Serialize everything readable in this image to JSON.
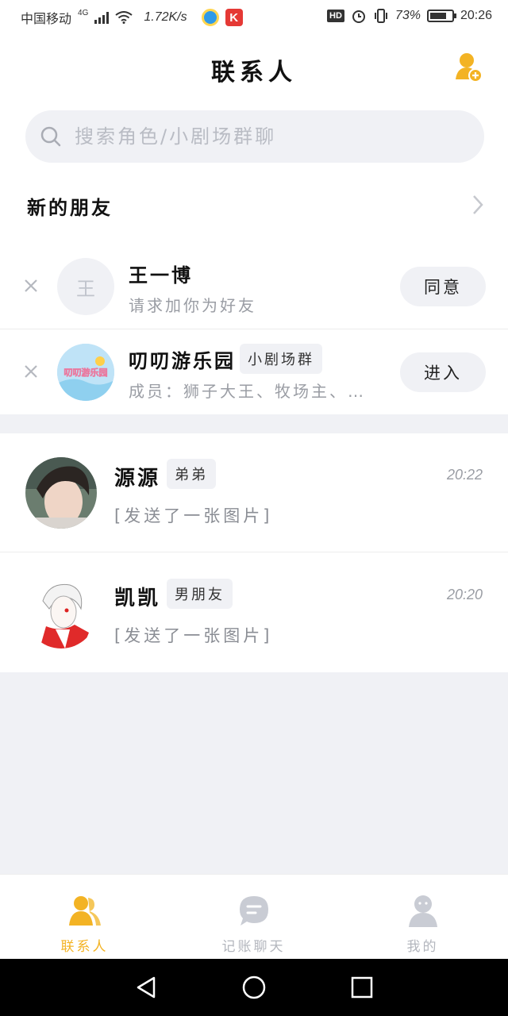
{
  "status_bar": {
    "carrier": "中国移动",
    "network": "4G",
    "speed": "1.72K/s",
    "hd": "HD",
    "battery": "73%",
    "time": "20:26"
  },
  "header": {
    "title": "联系人"
  },
  "search": {
    "placeholder": "搜索角色/小剧场群聊"
  },
  "new_friends": {
    "label": "新的朋友"
  },
  "requests": [
    {
      "avatar_text": "王",
      "name": "王一博",
      "subtitle": "请求加你为好友",
      "action": "同意"
    },
    {
      "name": "叨叨游乐园",
      "tag": "小剧场群",
      "subtitle": "成员：狮子大王、牧场主、…",
      "action": "进入",
      "avatar_text": "叨叨游乐园"
    }
  ],
  "chats": [
    {
      "name": "源源",
      "tag": "弟弟",
      "time": "20:22",
      "preview": "[发送了一张图片]"
    },
    {
      "name": "凯凯",
      "tag": "男朋友",
      "time": "20:20",
      "preview": "[发送了一张图片]"
    }
  ],
  "tabs": [
    {
      "label": "联系人",
      "active": true
    },
    {
      "label": "记账聊天",
      "active": false
    },
    {
      "label": "我的",
      "active": false
    }
  ],
  "colors": {
    "accent": "#f3b324",
    "background_gray": "#f0f1f5",
    "inactive_icon": "#c9ccd4"
  }
}
